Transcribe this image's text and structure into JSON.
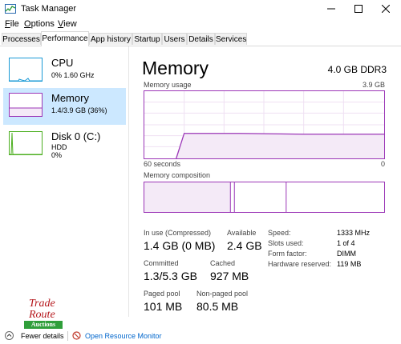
{
  "window": {
    "title": "Task Manager"
  },
  "menu": [
    "File",
    "Options",
    "View"
  ],
  "tabs": [
    "Processes",
    "Performance",
    "App history",
    "Startup",
    "Users",
    "Details",
    "Services"
  ],
  "active_tab": "Performance",
  "sidebar": [
    {
      "name": "CPU",
      "line1": "0%  1.60 GHz",
      "line2": ""
    },
    {
      "name": "Memory",
      "line1": "1.4/3.9 GB (36%)",
      "line2": ""
    },
    {
      "name": "Disk 0 (C:)",
      "line1": "HDD",
      "line2": "0%"
    }
  ],
  "main": {
    "title": "Memory",
    "spec": "4.0 GB DDR3",
    "graph_label": "Memory usage",
    "graph_max": "3.9 GB",
    "graph_time": "60 seconds",
    "graph_min": "0",
    "composition_label": "Memory composition",
    "stats": {
      "in_use_label": "In use (Compressed)",
      "in_use_value": "1.4 GB (0 MB)",
      "available_label": "Available",
      "available_value": "2.4 GB",
      "committed_label": "Committed",
      "committed_value": "1.3/5.3 GB",
      "cached_label": "Cached",
      "cached_value": "927 MB",
      "paged_label": "Paged pool",
      "paged_value": "101 MB",
      "nonpaged_label": "Non-paged pool",
      "nonpaged_value": "80.5 MB"
    },
    "details": [
      {
        "label": "Speed:",
        "value": "1333 MHz"
      },
      {
        "label": "Slots used:",
        "value": "1 of 4"
      },
      {
        "label": "Form factor:",
        "value": "DIMM"
      },
      {
        "label": "Hardware reserved:",
        "value": "119 MB"
      }
    ]
  },
  "footer": {
    "fewer_details": "Fewer details",
    "open_monitor": "Open Resource Monitor"
  },
  "logo": {
    "line1": "Trade",
    "line2": "Route",
    "line3": "Auctions"
  },
  "colors": {
    "accent": "#9b36b7",
    "selected_bg": "#cce8ff",
    "cpu": "#1a9ad6",
    "disk": "#4caf20",
    "link": "#0066cc"
  }
}
